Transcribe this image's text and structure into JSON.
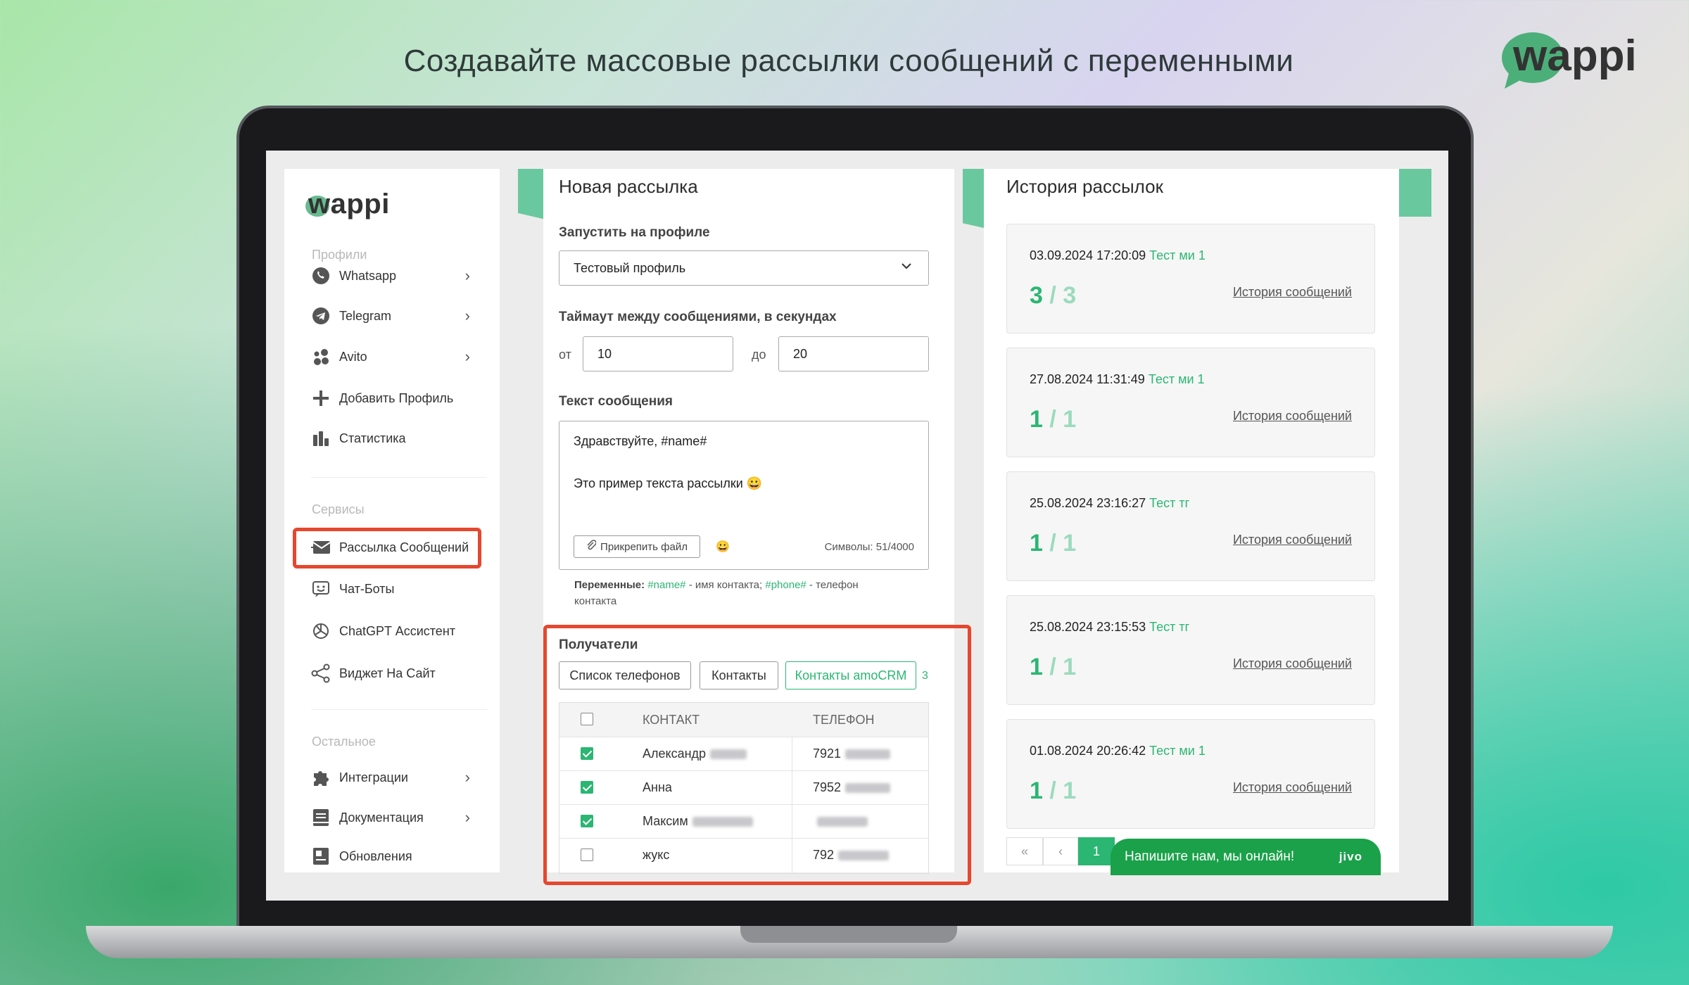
{
  "headline": "Создавайте массовые рассылки сообщений с переменными",
  "brand": "wappi",
  "colors": {
    "accent": "#2bb673",
    "highlight": "#e5472f",
    "strip": "#6ac89f"
  },
  "sidebar": {
    "logo": "wappi",
    "section_profiles": "Профили",
    "section_services": "Сервисы",
    "section_other": "Остальное",
    "items": [
      {
        "label": "Whatsapp",
        "icon": "whatsapp-icon"
      },
      {
        "label": "Telegram",
        "icon": "telegram-icon"
      },
      {
        "label": "Avito",
        "icon": "avito-icon"
      },
      {
        "label": "Добавить Профиль",
        "icon": "plus-icon"
      },
      {
        "label": "Статистика",
        "icon": "chart-icon"
      },
      {
        "label": "Рассылка Сообщений",
        "icon": "envelope-icon"
      },
      {
        "label": "Чат-Боты",
        "icon": "chatbot-icon"
      },
      {
        "label": "ChatGPT Ассистент",
        "icon": "openai-icon"
      },
      {
        "label": "Виджет На Сайт",
        "icon": "share-icon"
      },
      {
        "label": "Интеграции",
        "icon": "puzzle-icon"
      },
      {
        "label": "Документация",
        "icon": "book-icon"
      },
      {
        "label": "Обновления",
        "icon": "updates-icon"
      }
    ]
  },
  "new_mailing": {
    "title": "Новая рассылка",
    "profile_label": "Запустить на профиле",
    "profile_value": "Тестовый профиль",
    "timeout_label": "Таймаут между сообщениями, в секундах",
    "from_label": "от",
    "from_value": "10",
    "to_label": "до",
    "to_value": "20",
    "text_label": "Текст сообщения",
    "text_line1": "Здравствуйте, #name#",
    "text_line2": "Это пример текста рассылки 😀",
    "attach_label": "Прикрепить файл",
    "emoji": "😀",
    "chars": "Символы: 51/4000",
    "vars_title": "Переменные:",
    "var_name": "#name#",
    "var_name_desc": " - имя контакта;",
    "var_phone": "#phone#",
    "var_phone_desc": " - телефон",
    "vars_line2": "контакта",
    "recipients_label": "Получатели",
    "tabs": [
      "Список телефонов",
      "Контакты",
      "Контакты amoCRM"
    ],
    "recipients_count": "3",
    "table": {
      "col_contact": "КОНТАКТ",
      "col_phone": "ТЕЛЕФОН",
      "rows": [
        {
          "checked": true,
          "name": "Александр",
          "phone": "7921"
        },
        {
          "checked": true,
          "name": "Анна",
          "phone": "7952"
        },
        {
          "checked": true,
          "name": "Максим",
          "phone": ""
        },
        {
          "checked": false,
          "name": "жукс",
          "phone": "792"
        }
      ]
    }
  },
  "history": {
    "title": "История рассылок",
    "link_label": "История сообщений",
    "items": [
      {
        "date": "03.09.2024 17:20:09",
        "profile": "Тест ми 1",
        "sent": "3",
        "total": "3"
      },
      {
        "date": "27.08.2024 11:31:49",
        "profile": "Тест ми 1",
        "sent": "1",
        "total": "1"
      },
      {
        "date": "25.08.2024 23:16:27",
        "profile": "Тест тг",
        "sent": "1",
        "total": "1"
      },
      {
        "date": "25.08.2024 23:15:53",
        "profile": "Тест тг",
        "sent": "1",
        "total": "1"
      },
      {
        "date": "01.08.2024 20:26:42",
        "profile": "Тест ми 1",
        "sent": "1",
        "total": "1"
      }
    ],
    "pager_first": "«",
    "pager_prev": "‹",
    "pager_current": "1"
  },
  "chat_widget": {
    "text": "Напишите нам, мы онлайн!",
    "brand": "jivo"
  }
}
